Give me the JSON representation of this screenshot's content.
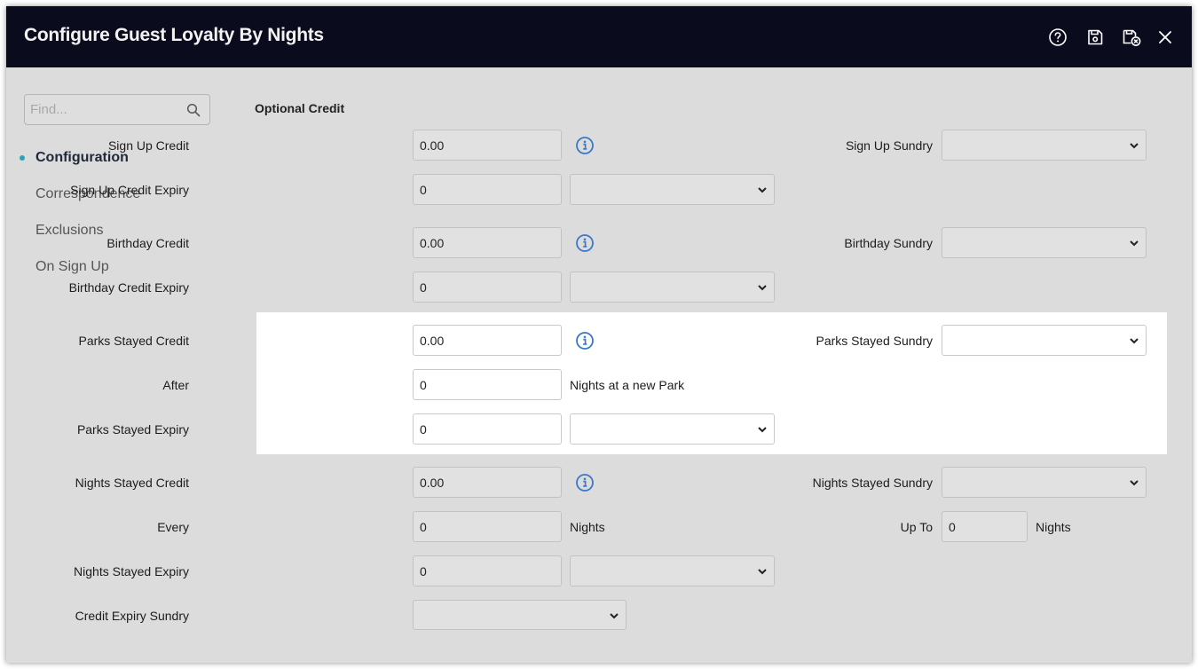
{
  "window": {
    "title": "Configure Guest Loyalty By Nights"
  },
  "toolbar": {
    "icons": [
      "help-icon",
      "save-icon",
      "save-and-close-icon",
      "close-icon"
    ]
  },
  "sidebar": {
    "find_placeholder": "Find...",
    "items": [
      {
        "label": "Configuration",
        "active": true
      },
      {
        "label": "Correspondence",
        "active": false
      },
      {
        "label": "Exclusions",
        "active": false
      },
      {
        "label": "On Sign Up",
        "active": false
      }
    ]
  },
  "form": {
    "section_title": "Optional Credit",
    "sign_up_credit": {
      "label": "Sign Up Credit",
      "value": "0.00"
    },
    "sign_up_sundry": {
      "label": "Sign Up Sundry",
      "value": ""
    },
    "sign_up_credit_expiry": {
      "label": "Sign Up Credit Expiry",
      "value": "0",
      "unit": ""
    },
    "birthday_credit": {
      "label": "Birthday Credit",
      "value": "0.00"
    },
    "birthday_sundry": {
      "label": "Birthday Sundry",
      "value": ""
    },
    "birthday_credit_expiry": {
      "label": "Birthday Credit Expiry",
      "value": "0",
      "unit": ""
    },
    "parks_stayed_credit": {
      "label": "Parks Stayed Credit",
      "value": "0.00"
    },
    "parks_stayed_sundry": {
      "label": "Parks Stayed Sundry",
      "value": ""
    },
    "after": {
      "label": "After",
      "value": "0",
      "suffix": "Nights at a new Park"
    },
    "parks_stayed_expiry": {
      "label": "Parks Stayed Expiry",
      "value": "0",
      "unit": ""
    },
    "nights_stayed_credit": {
      "label": "Nights Stayed Credit",
      "value": "0.00"
    },
    "nights_stayed_sundry": {
      "label": "Nights Stayed Sundry",
      "value": ""
    },
    "every": {
      "label": "Every",
      "value": "0",
      "suffix": "Nights"
    },
    "up_to": {
      "label": "Up To",
      "value": "0",
      "suffix": "Nights"
    },
    "nights_stayed_expiry": {
      "label": "Nights Stayed Expiry",
      "value": "0",
      "unit": ""
    },
    "credit_expiry_sundry": {
      "label": "Credit Expiry Sundry",
      "value": ""
    }
  },
  "colors": {
    "titlebar_bg": "#0b0b1e",
    "content_bg": "#dcdcdc",
    "highlight_bg": "#ffffff",
    "info_icon": "#3a78c9",
    "active_dot": "#2aa3b8"
  }
}
